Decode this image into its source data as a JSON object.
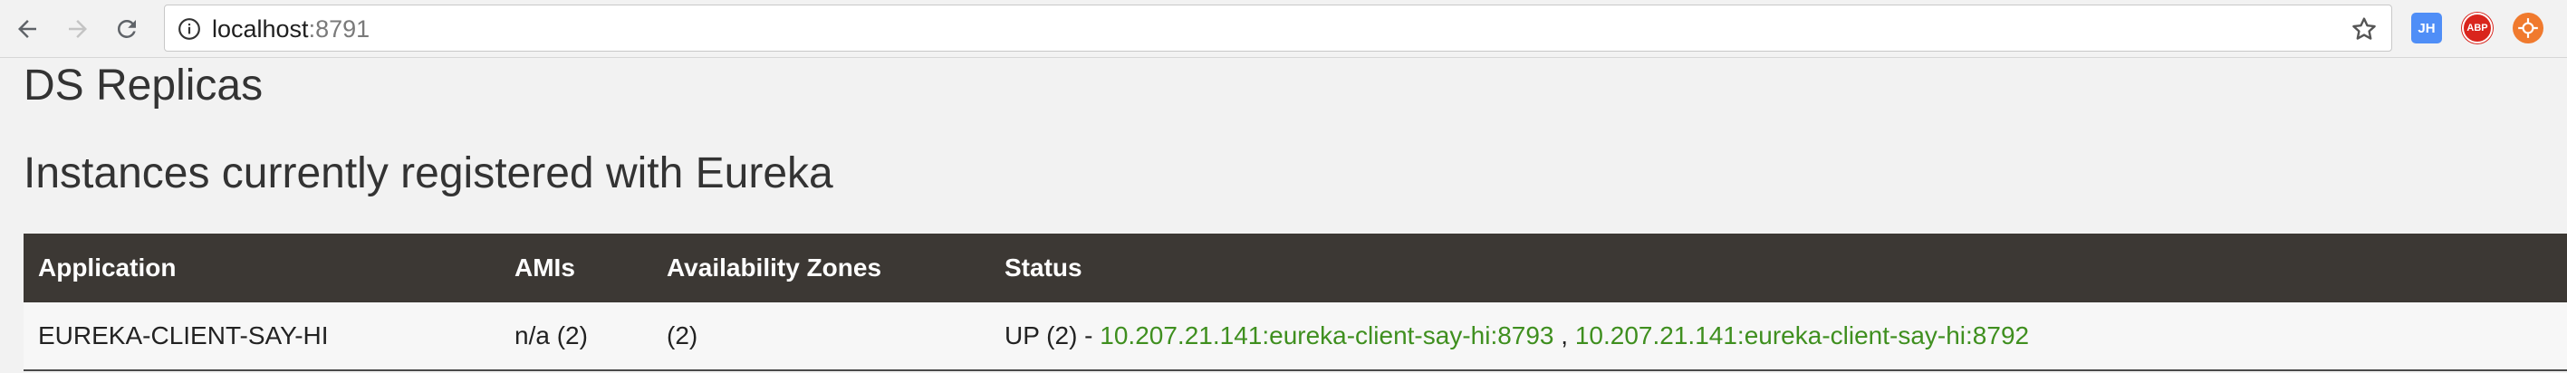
{
  "browser": {
    "url_host": "localhost",
    "url_port": ":8791",
    "back_icon": "arrow-left-icon",
    "forward_icon": "arrow-right-icon",
    "reload_icon": "reload-icon",
    "info_icon": "info-icon",
    "bookmark_icon": "star-icon",
    "extensions": [
      {
        "label": "JH",
        "color": "#4f8ef7"
      },
      {
        "label": "ABP",
        "color": "#d9251d"
      },
      {
        "label": "",
        "color": "#f07a2e"
      }
    ]
  },
  "page": {
    "title": "DS Replicas",
    "section_title": "Instances currently registered with Eureka"
  },
  "table": {
    "headers": [
      "Application",
      "AMIs",
      "Availability Zones",
      "Status"
    ],
    "rows": [
      {
        "application": "EUREKA-CLIENT-SAY-HI",
        "amis": "n/a (2)",
        "zones": "(2)",
        "status_prefix": "UP (2) - ",
        "links": [
          "10.207.21.141:eureka-client-say-hi:8793",
          "10.207.21.141:eureka-client-say-hi:8792"
        ],
        "link_separator": " , "
      }
    ]
  },
  "colors": {
    "header_bg": "#3c3834",
    "link": "#3f8f1f",
    "page_bg": "#f2f2f2"
  }
}
